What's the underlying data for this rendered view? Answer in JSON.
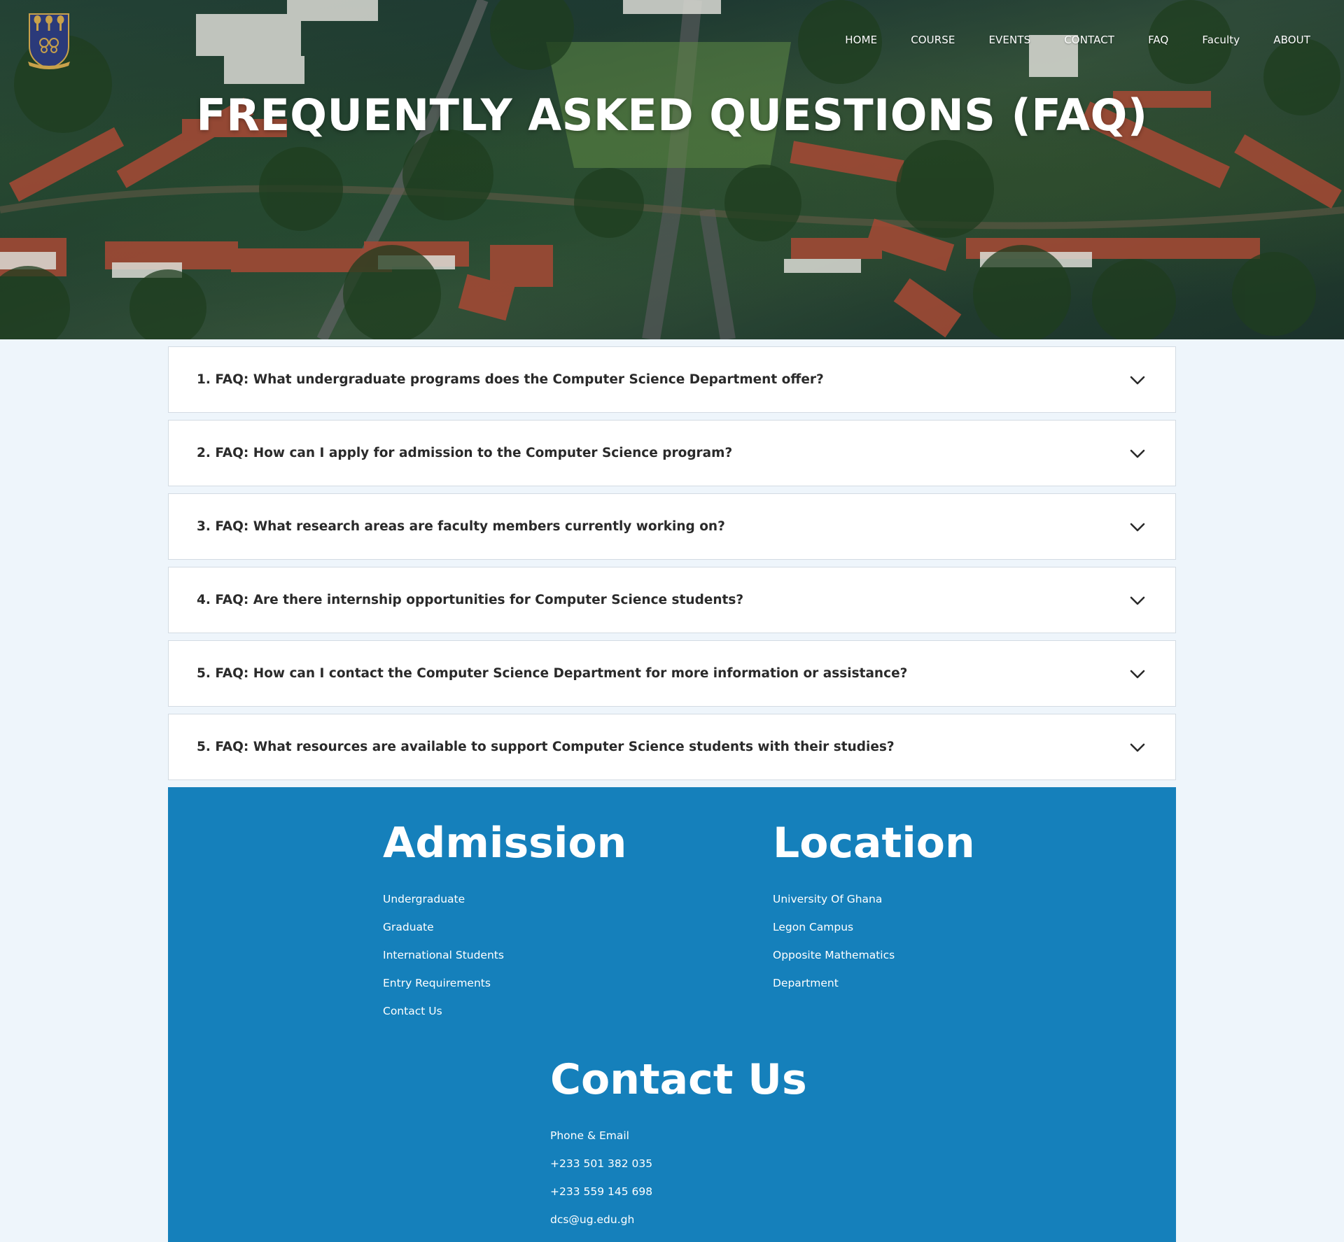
{
  "nav": {
    "items": [
      "HOME",
      "COURSE",
      "EVENTS",
      "CONTACT",
      "FAQ",
      "Faculty",
      "ABOUT"
    ]
  },
  "logo": {
    "icon": "university-crest-icon"
  },
  "hero": {
    "title": "FREQUENTLY ASKED QUESTIONS (FAQ)"
  },
  "faq": {
    "items": [
      "1. FAQ: What undergraduate programs does the Computer Science Department offer?",
      "2. FAQ: How can I apply for admission to the Computer Science program?",
      "3. FAQ: What research areas are faculty members currently working on?",
      "4. FAQ: Are there internship opportunities for Computer Science students?",
      "5. FAQ: How can I contact the Computer Science Department for more information or assistance?",
      "5. FAQ: What resources are available to support Computer Science students with their studies?"
    ],
    "toggle_icon": "chevron-down-icon"
  },
  "footer": {
    "admission": {
      "heading": "Admission",
      "links": [
        "Undergraduate",
        "Graduate",
        "International Students",
        "Entry Requirements",
        "Contact Us"
      ]
    },
    "location": {
      "heading": "Location",
      "lines": [
        "University Of Ghana",
        "Legon Campus",
        "Opposite Mathematics",
        "Department"
      ]
    },
    "contact": {
      "heading": "Contact Us",
      "lines": [
        "Phone & Email",
        "+233 501 382 035",
        "+233 559 145 698",
        "dcs@ug.edu.gh"
      ]
    }
  },
  "colors": {
    "footer_bg": "#1580bb",
    "page_bg": "#eef5fb",
    "faq_border": "#d3dbe3",
    "crest_blue": "#2b3a7a",
    "crest_gold": "#c9a14a"
  }
}
